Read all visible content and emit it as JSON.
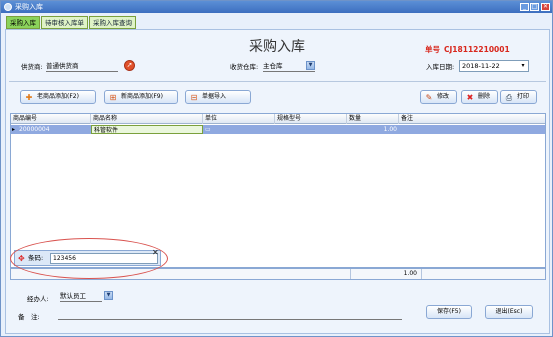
{
  "window": {
    "title": "采购入库"
  },
  "tabs": [
    {
      "label": "采购入库",
      "active": true
    },
    {
      "label": "待审核入库单",
      "active": false
    },
    {
      "label": "采购入库查询",
      "active": false
    }
  ],
  "header": {
    "title": "采购入库",
    "order_label": "单号",
    "order_no": "CJ18112210001"
  },
  "form": {
    "supplier_label": "供货商:",
    "supplier_value": "普通供货商",
    "warehouse_label": "收货仓库:",
    "warehouse_value": "主仓库",
    "date_label": "入库日期:",
    "date_value": "2018-11-22"
  },
  "toolbar": {
    "old_product": "老商品添加(F2)",
    "new_product": "新商品添加(F9)",
    "import": "单据导入",
    "edit": "修改",
    "delete": "删除",
    "print": "打印"
  },
  "grid": {
    "columns": [
      "商品编号",
      "商品名称",
      "单位",
      "规格型号",
      "数量",
      "备注"
    ],
    "rows": [
      {
        "code": "20000004",
        "name": "科管软件",
        "unit": "",
        "spec": "",
        "qty": "1.00",
        "note": ""
      }
    ],
    "total_qty": "1.00"
  },
  "barcode": {
    "label": "条码:",
    "value": "123456"
  },
  "footer": {
    "handler_label": "经办人:",
    "handler_value": "默认员工",
    "note_label": "备　注:",
    "save": "保存(F5)",
    "exit": "退出(Esc)"
  },
  "colors": {
    "order_no": "#d8261c",
    "active_tab": "#8bd35b",
    "selected_row": "#8fa9e0"
  }
}
